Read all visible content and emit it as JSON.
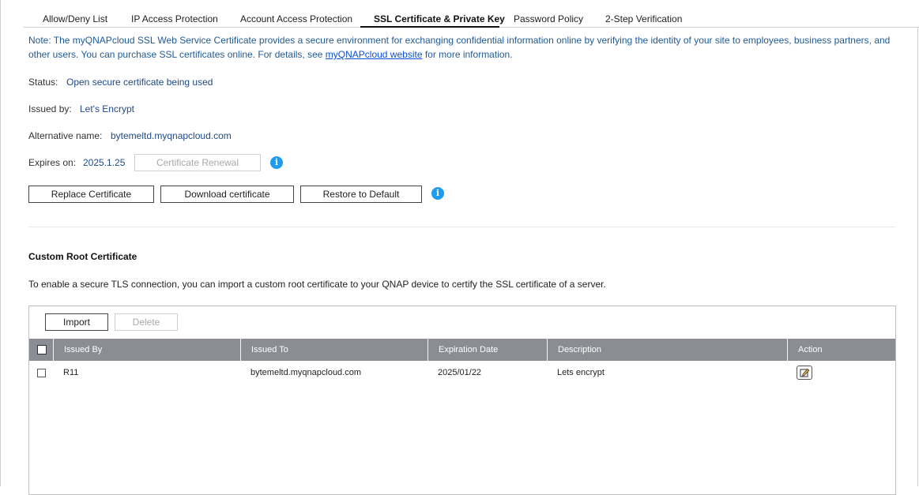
{
  "tabs": [
    {
      "label": "Allow/Deny List"
    },
    {
      "label": "IP Access Protection"
    },
    {
      "label": "Account Access Protection"
    },
    {
      "label": "SSL Certificate & Private Key",
      "active": true
    },
    {
      "label": "Password Policy"
    },
    {
      "label": "2-Step Verification"
    }
  ],
  "note": {
    "text_before": "Note: The myQNAPcloud SSL Web Service Certificate provides a secure environment for exchanging confidential information online by verifying the identity of your site to employees, business partners, and other users. You can purchase SSL certificates online. For details, see ",
    "link": "myQNAPcloud website",
    "text_after": " for more information."
  },
  "certificate": {
    "status_label": "Status:",
    "status_value": "Open secure certificate being used",
    "issued_by_label": "Issued by:",
    "issued_by_value": "Let's Encrypt",
    "alt_name_label": "Alternative name:",
    "alt_name_value": "bytemeltd.myqnapcloud.com",
    "expires_label": "Expires on:",
    "expires_value": "2025.1.25",
    "renewal_button": "Certificate Renewal"
  },
  "actions": {
    "replace": "Replace Certificate",
    "download": "Download certificate",
    "restore": "Restore to Default"
  },
  "custom_root": {
    "title": "Custom Root Certificate",
    "description": "To enable a secure TLS connection, you can import a custom root certificate to your QNAP device to certify the SSL certificate of a server.",
    "import_button": "Import",
    "delete_button": "Delete",
    "columns": [
      "Issued By",
      "Issued To",
      "Expiration Date",
      "Description",
      "Action"
    ],
    "rows": [
      {
        "issued_by": "R11",
        "issued_to": "bytemeltd.myqnapcloud.com",
        "expiration": "2025/01/22",
        "description": "Lets encrypt"
      }
    ]
  },
  "icons": {
    "info": "info-icon",
    "edit": "edit-icon"
  },
  "colors": {
    "link": "#0b4fd6",
    "note_text": "#1f5a96",
    "value_text": "#1f4a86",
    "info_icon": "#1e9cf0",
    "table_header": "#8a8e94"
  }
}
